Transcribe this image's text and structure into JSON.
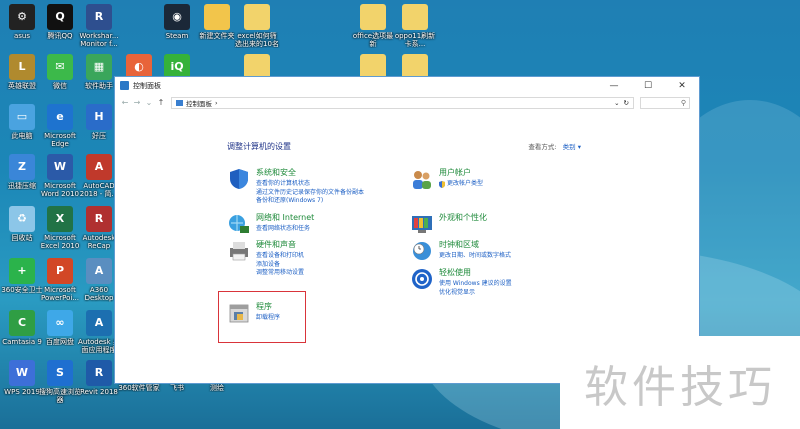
{
  "window": {
    "title": "控制面板",
    "breadcrumb": "控制面板",
    "heading": "调整计算机的设置",
    "view_by_label": "查看方式:",
    "view_by_value": "类别"
  },
  "categories": [
    {
      "title": "系统和安全",
      "links": [
        "查看你的计算机状态",
        "通过文件历史记录保存你的文件备份副本",
        "备份和还原(Windows 7)"
      ]
    },
    {
      "title": "网络和 Internet",
      "links": [
        "查看网络状态和任务"
      ]
    },
    {
      "title": "硬件和声音",
      "links": [
        "查看设备和打印机",
        "添加设备",
        "调整常用移动设置"
      ]
    },
    {
      "title": "程序",
      "links": [
        "卸载程序"
      ]
    },
    {
      "title": "用户帐户",
      "links": [
        "更改帐户类型"
      ]
    },
    {
      "title": "外观和个性化",
      "links": []
    },
    {
      "title": "时钟和区域",
      "links": [
        "更改日期、时间或数字格式"
      ]
    },
    {
      "title": "轻松使用",
      "links": [
        "使用 Windows 建议的设置",
        "优化视觉显示"
      ]
    }
  ],
  "desktop": {
    "col1": [
      "asus",
      "英雄联盟",
      "此电脑",
      "迅捷压缩",
      "回收站",
      "360安全卫士",
      "Camtasia 9",
      "WPS 2019"
    ],
    "col2": [
      "腾讯QQ",
      "微信",
      "Microsoft Edge",
      "Microsoft Word 2010",
      "Microsoft Excel 2010",
      "Microsoft PowerPoi...",
      "百度网盘",
      "搜狗高速浏览器"
    ],
    "col3": [
      "Workshar... Monitor f...",
      "软件助手",
      "好压",
      "AutoCAD 2018 - 简...",
      "Autodesk ReCap",
      "A360 Desktop",
      "Autodesk 桌面应用程序",
      "Revit 2018"
    ],
    "top_row": [
      "Steam",
      "新建文件夹",
      "excel如何筛选出来的10名",
      "office选项最新",
      "oppo11刷新卡系..."
    ],
    "bottom_row": [
      "360软件管家",
      "飞书",
      "测绘"
    ]
  },
  "watermark": "软件技巧"
}
